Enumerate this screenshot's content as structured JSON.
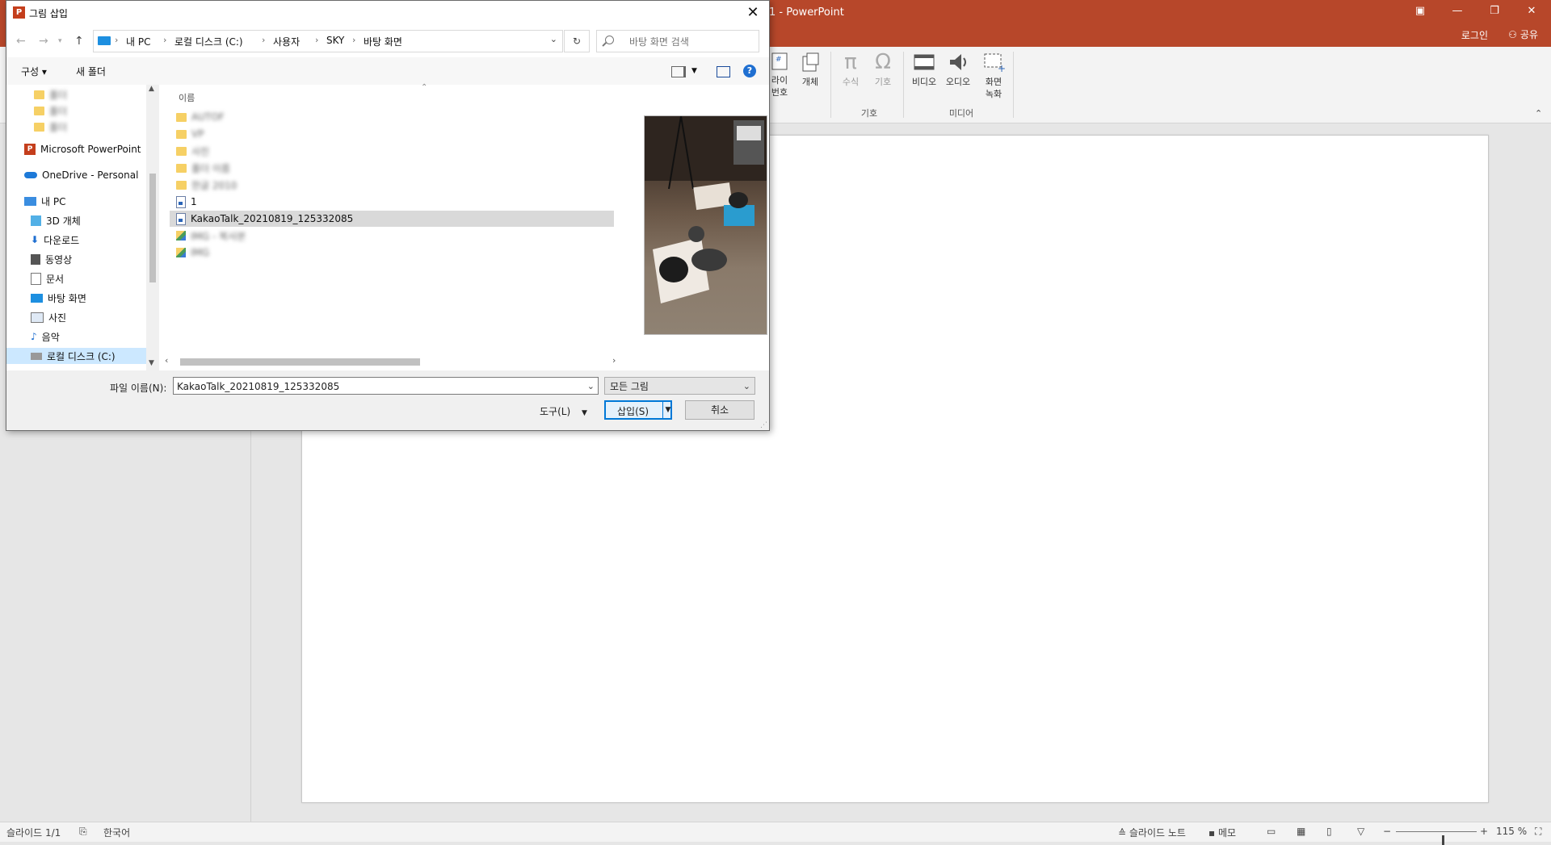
{
  "ppt": {
    "title": "1 - PowerPoint",
    "login": "로그인",
    "share": "공유",
    "ribbon": {
      "slide_number": "라이\n번호",
      "object": "개체",
      "equation": "수식",
      "symbol": "기호",
      "video": "비디오",
      "audio": "오디오",
      "screen_recording": "화면\n녹화",
      "group_symbols": "기호",
      "group_media": "미디어"
    },
    "status": {
      "slide_counter": "슬라이드 1/1",
      "language": "한국어",
      "notes": "슬라이드 노트",
      "comments": "메모",
      "zoom": "115 %",
      "zoom_level": 0.58
    }
  },
  "dialog": {
    "title": "그림 삽입",
    "breadcrumb": [
      "내 PC",
      "로컬 디스크 (C:)",
      "사용자",
      "SKY",
      "바탕 화면"
    ],
    "search_placeholder": "바탕 화면 검색",
    "organize": "구성 ▾",
    "new_folder": "새 폴더",
    "nav": {
      "blurred_folders": [
        "폴더",
        "폴더",
        "폴더"
      ],
      "powerpoint": "Microsoft PowerPoint",
      "onedrive": "OneDrive - Personal",
      "this_pc": "내 PC",
      "items": [
        "3D 개체",
        "다운로드",
        "동영상",
        "문서",
        "바탕 화면",
        "사진",
        "음악",
        "로컬 디스크 (C:)"
      ]
    },
    "column_name": "이름",
    "files": [
      {
        "name": "AUTOF",
        "type": "folder",
        "blurred": true
      },
      {
        "name": "VP",
        "type": "folder",
        "blurred": true
      },
      {
        "name": "사진",
        "type": "folder",
        "blurred": true
      },
      {
        "name": "폴더 이름",
        "type": "folder",
        "blurred": true
      },
      {
        "name": "한글 2010",
        "type": "folder",
        "blurred": true
      },
      {
        "name": "1",
        "type": "doc",
        "blurred": false
      },
      {
        "name": "KakaoTalk_20210819_125332085",
        "type": "doc",
        "blurred": false,
        "selected": true
      },
      {
        "name": "IMG - 복사본",
        "type": "image",
        "blurred": true
      },
      {
        "name": "IMG",
        "type": "image",
        "blurred": true
      }
    ],
    "file_name_label": "파일 이름(N):",
    "file_name_value": "KakaoTalk_20210819_125332085",
    "filter": "모든 그림",
    "tools": "도구(L)",
    "insert": "삽입(S)",
    "cancel": "취소"
  }
}
